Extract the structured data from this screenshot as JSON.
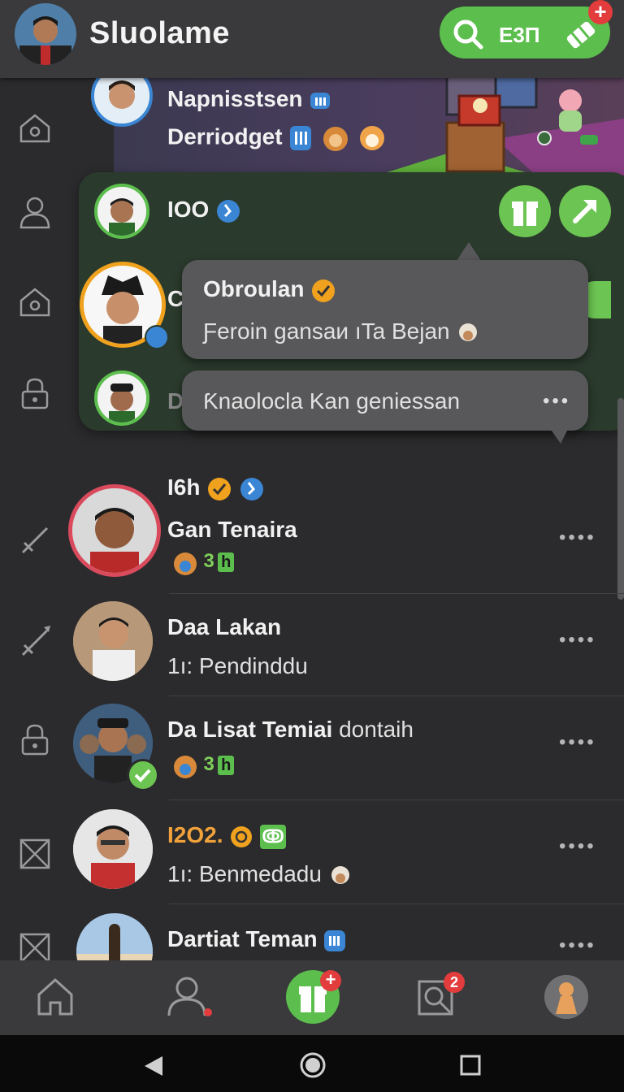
{
  "header": {
    "title": "Sluolame",
    "pill_text": "E3Π",
    "pill_badge": "+"
  },
  "top_card": {
    "name": "Napnisstsen",
    "subtitle": "Derriodget"
  },
  "group": {
    "first_name": "ƖOO",
    "second_initial": "C",
    "third_initial": "D"
  },
  "popup": {
    "title": "Obroulan",
    "line": "Ƒeroin gansaи ıTa Beјan",
    "message": "Ƙnaolocla Kan geniessan"
  },
  "chats": [
    {
      "title": "Ɩ6h",
      "name": "Gan Tenaira",
      "count": "3",
      "badge": "h"
    },
    {
      "name": "Daa Lakan",
      "preview": "1ı: Pendinddu"
    },
    {
      "name_bold": "Da Lisat Temiai",
      "name_rest": "dontaih",
      "count": "3",
      "badge": "h"
    },
    {
      "title": "Ɩ2O2.",
      "badge": "ↂ",
      "preview": "1ı: Benmedadu"
    },
    {
      "name": "Dartiat Teman"
    }
  ],
  "nav": {
    "gift_badge": "+",
    "search_badge": "2"
  },
  "colors": {
    "accent_green": "#5cbe4d",
    "badge_red": "#e23c3c",
    "verified_blue": "#3a86d4",
    "verified_gold": "#f0a21e",
    "orange_text": "#f2a23a"
  }
}
